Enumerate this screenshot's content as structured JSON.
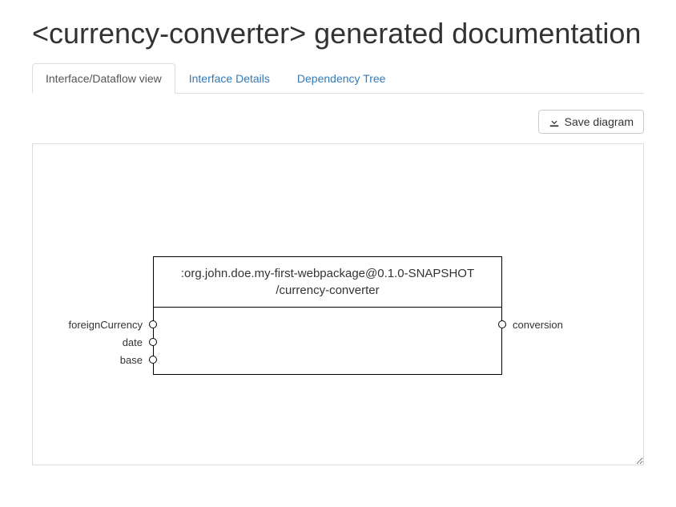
{
  "title": "<currency-converter> generated documentation",
  "tabs": [
    {
      "label": "Interface/Dataflow view",
      "active": true
    },
    {
      "label": "Interface Details",
      "active": false
    },
    {
      "label": "Dependency Tree",
      "active": false
    }
  ],
  "toolbar": {
    "save_label": "Save diagram"
  },
  "diagram": {
    "component_title": ":org.john.doe.my-first-webpackage@0.1.0-SNAPSHOT\n/currency-converter",
    "inputs": [
      {
        "name": "foreignCurrency"
      },
      {
        "name": "date"
      },
      {
        "name": "base"
      }
    ],
    "outputs": [
      {
        "name": "conversion"
      }
    ]
  }
}
